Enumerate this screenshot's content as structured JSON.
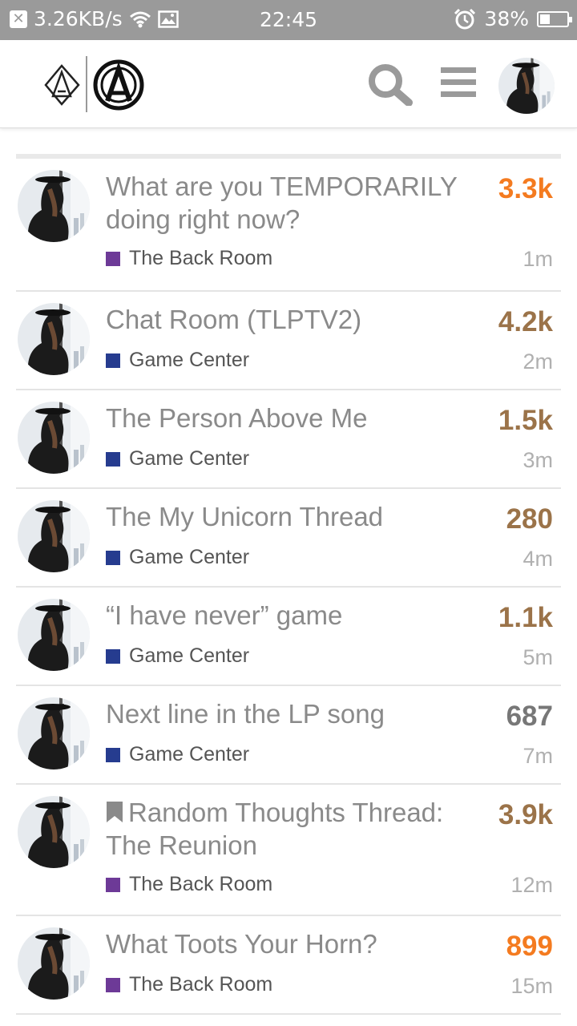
{
  "status_bar": {
    "net_speed": "3.26KB/s",
    "time": "22:45",
    "battery": "38%",
    "battery_level": 0.38,
    "icons": [
      "close-notification-icon",
      "wifi-icon",
      "image-icon",
      "alarm-icon",
      "battery-icon"
    ]
  },
  "header": {
    "icons": [
      "linkin-park-logo",
      "search-icon",
      "hamburger-menu-icon",
      "user-avatar"
    ]
  },
  "colors": {
    "hot": "#f47b20",
    "warm": "#9b7349",
    "neutral": "#777777",
    "back_room": "#6d3a97",
    "game_center": "#263c8f"
  },
  "topics": [
    {
      "title": "What are you TEMPORARILY doing right now?",
      "category": "The Back Room",
      "category_color": "#6d3a97",
      "count": "3.3k",
      "count_color": "#f47b20",
      "age": "1m",
      "bookmarked": false
    },
    {
      "title": "Chat Room (TLPTV2)",
      "category": "Game Center",
      "category_color": "#263c8f",
      "count": "4.2k",
      "count_color": "#9b7349",
      "age": "2m",
      "bookmarked": false
    },
    {
      "title": "The Person Above Me",
      "category": "Game Center",
      "category_color": "#263c8f",
      "count": "1.5k",
      "count_color": "#9b7349",
      "age": "3m",
      "bookmarked": false
    },
    {
      "title": "The My Unicorn Thread",
      "category": "Game Center",
      "category_color": "#263c8f",
      "count": "280",
      "count_color": "#9b7349",
      "age": "4m",
      "bookmarked": false
    },
    {
      "title": "“I have never” game",
      "category": "Game Center",
      "category_color": "#263c8f",
      "count": "1.1k",
      "count_color": "#9b7349",
      "age": "5m",
      "bookmarked": false
    },
    {
      "title": "Next line in the LP song",
      "category": "Game Center",
      "category_color": "#263c8f",
      "count": "687",
      "count_color": "#777777",
      "age": "7m",
      "bookmarked": false
    },
    {
      "title": "Random Thoughts Thread: The Reunion",
      "category": "The Back Room",
      "category_color": "#6d3a97",
      "count": "3.9k",
      "count_color": "#9b7349",
      "age": "12m",
      "bookmarked": true
    },
    {
      "title": "What Toots Your Horn?",
      "category": "The Back Room",
      "category_color": "#6d3a97",
      "count": "899",
      "count_color": "#f47b20",
      "age": "15m",
      "bookmarked": false
    }
  ]
}
